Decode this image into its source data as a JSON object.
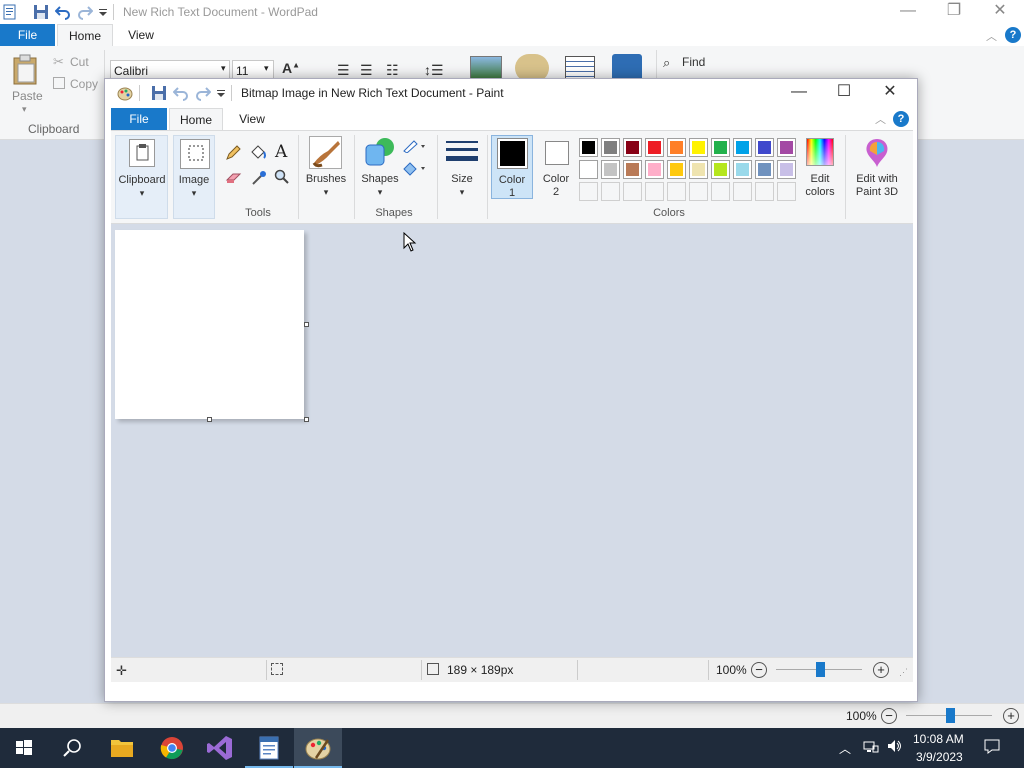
{
  "wordpad": {
    "title": "New Rich Text Document - WordPad",
    "tabs": {
      "file": "File",
      "home": "Home",
      "view": "View"
    },
    "paste": "Paste",
    "cut": "Cut",
    "copy": "Copy",
    "clipboard_group": "Clipboard",
    "font_name": "Calibri",
    "font_size": "11",
    "find": "Find",
    "zoom": "100%"
  },
  "paint": {
    "title": "Bitmap Image in New Rich Text Document - Paint",
    "tabs": {
      "file": "File",
      "home": "Home",
      "view": "View"
    },
    "clipboard": "Clipboard",
    "image": "Image",
    "tools_group": "Tools",
    "brushes": "Brushes",
    "shapes": "Shapes",
    "shapes_group": "Shapes",
    "size": "Size",
    "color1_line1": "Color",
    "color1_line2": "1",
    "color2_line1": "Color",
    "color2_line2": "2",
    "colors_group": "Colors",
    "edit_colors_line1": "Edit",
    "edit_colors_line2": "colors",
    "paint3d_line1": "Edit with",
    "paint3d_line2": "Paint 3D",
    "image_size": "189 × 189px",
    "zoom": "100%",
    "palette_row1": [
      "#000000",
      "#7f7f7f",
      "#880015",
      "#ed1c24",
      "#ff7f27",
      "#fff200",
      "#22b14c",
      "#00a2e8",
      "#3f48cc",
      "#a349a4"
    ],
    "palette_row2": [
      "#ffffff",
      "#c3c3c3",
      "#b97a57",
      "#ffaec9",
      "#ffc90e",
      "#efe4b0",
      "#b5e61d",
      "#99d9ea",
      "#7092be",
      "#c8bfe7"
    ],
    "color1": "#000000",
    "color2": "#ffffff"
  },
  "taskbar": {
    "time": "10:08 AM",
    "date": "3/9/2023",
    "apps": [
      "start-icon",
      "search-icon",
      "file-explorer-icon",
      "chrome-icon",
      "visual-studio-icon",
      "wordpad-icon",
      "paint-icon"
    ]
  },
  "accent": "#1979ca"
}
